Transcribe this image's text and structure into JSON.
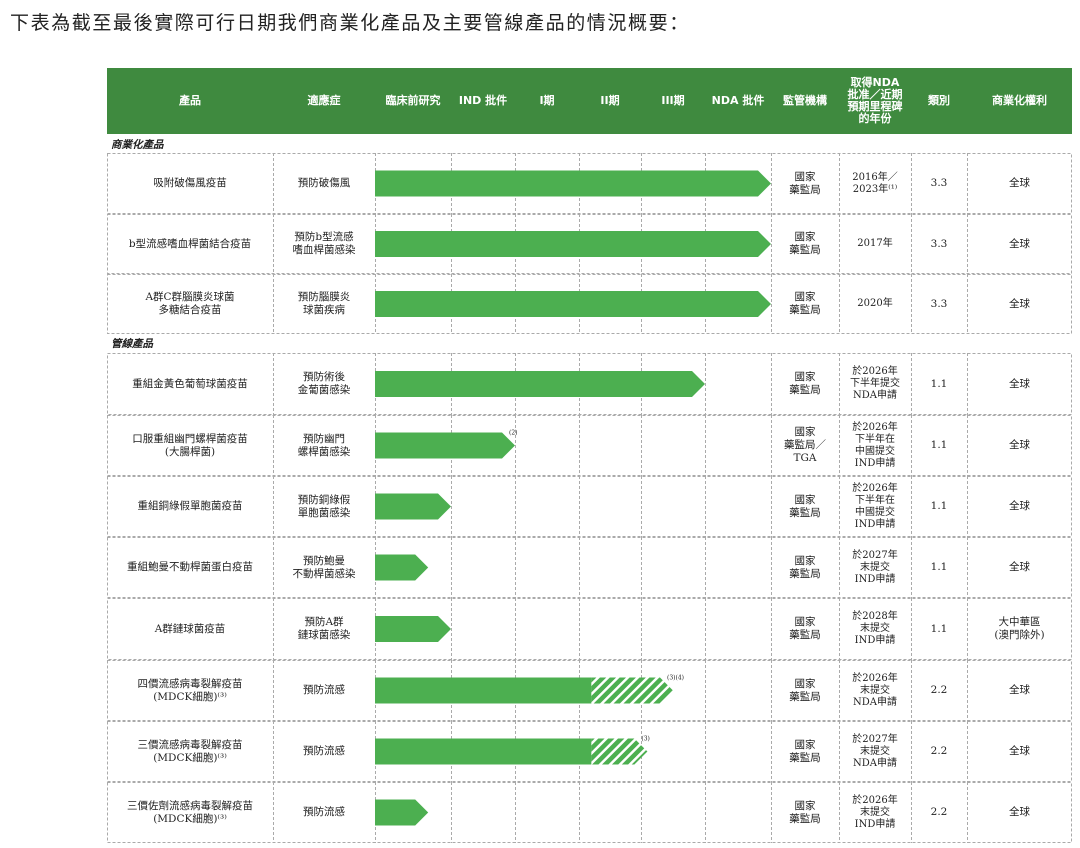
{
  "intro": "下表為截至最後實際可行日期我們商業化產品及主要管線產品的情況概要：",
  "header": {
    "product": "產品",
    "indication": "適應症",
    "preclinical": "臨床前研究",
    "ind": "IND 批件",
    "phase1": "I期",
    "phase2": "II期",
    "phase3": "III期",
    "nda": "NDA 批件",
    "regulator": "監管機構",
    "milestone": "取得NDA\n批准／近期\n預期里程碑\n的年份",
    "category": "類別",
    "rights": "商業化權利"
  },
  "sections": {
    "commercial": "商業化產品",
    "pipeline": "管線產品"
  },
  "colors": {
    "header_bg": "#3f8a3f",
    "bar": "#4caf50",
    "bar_hatch": "#ffffff",
    "grid": "#aaaaaa"
  },
  "stages": [
    "臨床前研究",
    "IND 批件",
    "I期",
    "II期",
    "III期",
    "NDA 批件"
  ],
  "rows": [
    {
      "product": "吸附破傷風疫苗",
      "indication": "預防破傷風",
      "stage_progress": 6,
      "hatched_progress": 0,
      "note": "",
      "regulator": "國家\n藥監局",
      "milestone": "2016年／\n2023年⁽¹⁾",
      "category": "3.3",
      "rights": "全球"
    },
    {
      "product": "b型流感嗜血桿菌結合疫苗",
      "indication": "預防b型流感\n嗜血桿菌感染",
      "stage_progress": 6,
      "hatched_progress": 0,
      "note": "",
      "regulator": "國家\n藥監局",
      "milestone": "2017年",
      "category": "3.3",
      "rights": "全球"
    },
    {
      "product": "A群C群腦膜炎球菌\n多糖結合疫苗",
      "indication": "預防腦膜炎\n球菌疾病",
      "stage_progress": 6,
      "hatched_progress": 0,
      "note": "",
      "regulator": "國家\n藥監局",
      "milestone": "2020年",
      "category": "3.3",
      "rights": "全球"
    },
    {
      "product": "重組金黃色葡萄球菌疫苗",
      "indication": "預防術後\n金葡菌感染",
      "stage_progress": 5,
      "hatched_progress": 0,
      "note": "",
      "regulator": "國家\n藥監局",
      "milestone": "於2026年\n下半年提交\nNDA申請",
      "category": "1.1",
      "rights": "全球"
    },
    {
      "product": "口服重組幽門螺桿菌疫苗\n(大腸桿菌)",
      "indication": "預防幽門\n螺桿菌感染",
      "stage_progress": 2,
      "hatched_progress": 0,
      "note": "(2)",
      "regulator": "國家\n藥監局／\nTGA",
      "milestone": "於2026年\n下半年在\n中國提交\nIND申請",
      "category": "1.1",
      "rights": "全球"
    },
    {
      "product": "重組銅綠假單胞菌疫苗",
      "indication": "預防銅綠假\n單胞菌感染",
      "stage_progress": 1,
      "hatched_progress": 0,
      "note": "",
      "regulator": "國家\n藥監局",
      "milestone": "於2026年\n下半年在\n中國提交\nIND申請",
      "category": "1.1",
      "rights": "全球"
    },
    {
      "product": "重組鮑曼不動桿菌蛋白疫苗",
      "indication": "預防鮑曼\n不動桿菌感染",
      "stage_progress": 0.7,
      "hatched_progress": 0,
      "note": "",
      "regulator": "國家\n藥監局",
      "milestone": "於2027年\n末提交\nIND申請",
      "category": "1.1",
      "rights": "全球"
    },
    {
      "product": "A群鏈球菌疫苗",
      "indication": "預防A群\n鏈球菌感染",
      "stage_progress": 1,
      "hatched_progress": 0,
      "note": "",
      "regulator": "國家\n藥監局",
      "milestone": "於2028年\n末提交\nIND申請",
      "category": "1.1",
      "rights": "大中華區\n(澳門除外)"
    },
    {
      "product": "四價流感病毒裂解疫苗\n(MDCK細胞)⁽³⁾",
      "indication": "預防流感",
      "stage_progress": 3.2,
      "hatched_progress": 4.5,
      "note": "(3)(4)",
      "regulator": "國家\n藥監局",
      "milestone": "於2026年\n末提交\nNDA申請",
      "category": "2.2",
      "rights": "全球"
    },
    {
      "product": "三價流感病毒裂解疫苗\n(MDCK細胞)⁽³⁾",
      "indication": "預防流感",
      "stage_progress": 3.2,
      "hatched_progress": 4.1,
      "note": "(3)",
      "regulator": "國家\n藥監局",
      "milestone": "於2027年\n末提交\nNDA申請",
      "category": "2.2",
      "rights": "全球"
    },
    {
      "product": "三價佐劑流感病毒裂解疫苗\n(MDCK細胞)⁽³⁾",
      "indication": "預防流感",
      "stage_progress": 0.7,
      "hatched_progress": 0,
      "note": "",
      "regulator": "國家\n藥監局",
      "milestone": "於2026年\n末提交\nIND申請",
      "category": "2.2",
      "rights": "全球"
    }
  ]
}
